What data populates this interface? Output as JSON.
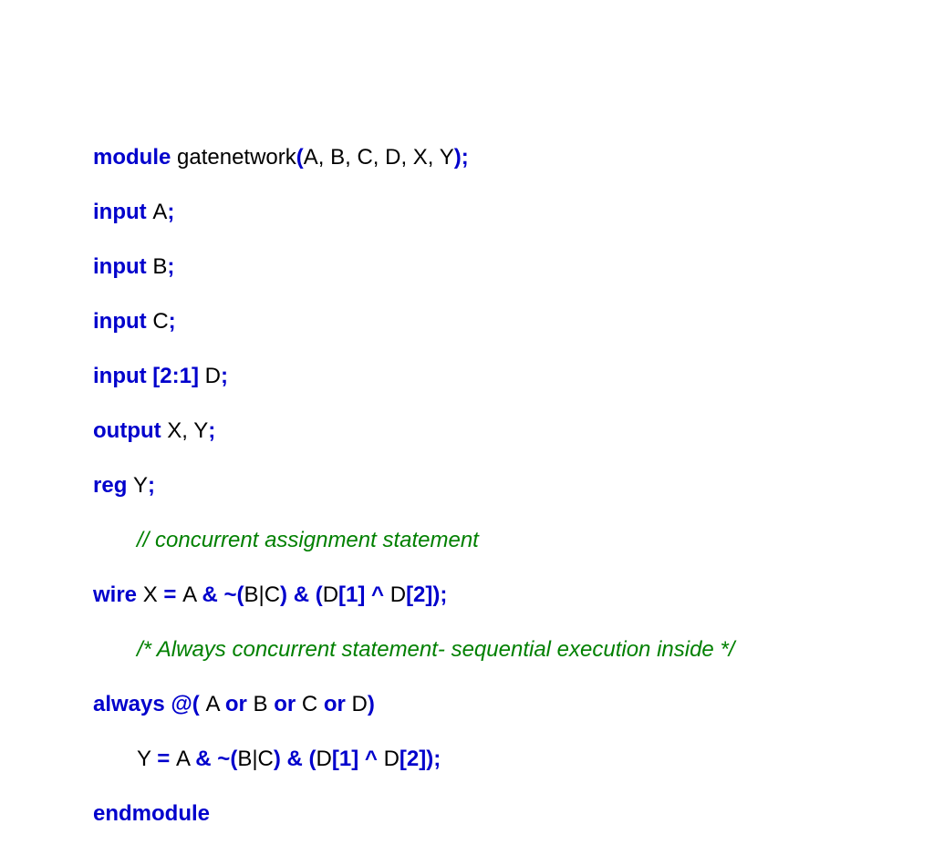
{
  "l1": {
    "a": "module ",
    "b": "gatenetwork",
    "c": "(",
    "d": "A, B, C, D, X, Y",
    "e": ");"
  },
  "l2": {
    "a": "input ",
    "b": "A",
    "c": ";"
  },
  "l3": {
    "a": "input ",
    "b": "B",
    "c": ";"
  },
  "l4": {
    "a": "input ",
    "b": "C",
    "c": ";"
  },
  "l5": {
    "a": "input [2:1] ",
    "b": "D",
    "c": ";"
  },
  "l6": {
    "a": "output ",
    "b": "X, Y",
    "c": ";"
  },
  "l7": {
    "a": "reg ",
    "b": "Y",
    "c": ";"
  },
  "l8": {
    "a": "// concurrent assignment statement"
  },
  "l9": {
    "a": "wire ",
    "b": "X ",
    "c": "= ",
    "d": "A ",
    "e": "& ~(",
    "f": "B|C",
    "g": ") & (",
    "h": "D",
    "i": "[1] ^ ",
    "j": "D",
    "k": "[2]);"
  },
  "l10": {
    "a": "/* Always concurrent statement- sequential execution inside */"
  },
  "l11": {
    "a": "always @( ",
    "b": "A ",
    "c": "or ",
    "d": "B ",
    "e": "or ",
    "f": "C ",
    "g": "or ",
    "h": "D",
    "i": ")"
  },
  "l12": {
    "a": "Y ",
    "b": "= ",
    "c": "A ",
    "d": "& ~(",
    "e": "B|C",
    "f": ") & (",
    "g": "D",
    "h": "[1] ^ ",
    "i": "D",
    "j": "[2]);"
  },
  "l13": {
    "a": "endmodule"
  }
}
